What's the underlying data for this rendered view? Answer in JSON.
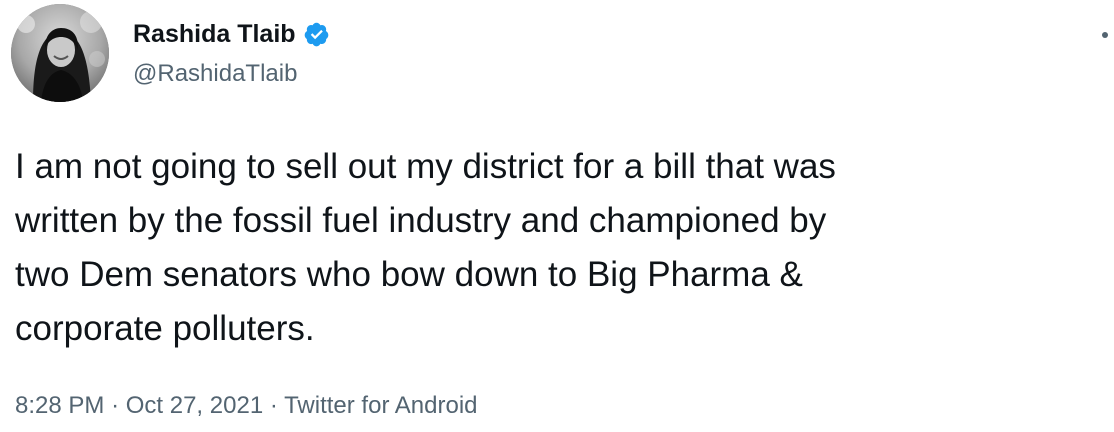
{
  "tweet": {
    "author": {
      "display_name": "Rashida Tlaib",
      "handle": "@RashidaTlaib",
      "verified": true,
      "avatar": "profile-photo"
    },
    "text": "I am not going to sell out my district for a bill that was\nwritten by the fossil fuel industry and championed by\ntwo Dem senators who bow down to Big Pharma &\ncorporate polluters.",
    "time": "8:28 PM",
    "separator": "·",
    "date": "Oct 27, 2021",
    "source": "Twitter for Android"
  },
  "colors": {
    "primary_text": "#0f1419",
    "secondary_text": "#536471",
    "verified_blue": "#1d9bf0",
    "background": "#ffffff"
  },
  "icons": {
    "verified": "verified-badge-icon",
    "more": "more-options-icon"
  }
}
